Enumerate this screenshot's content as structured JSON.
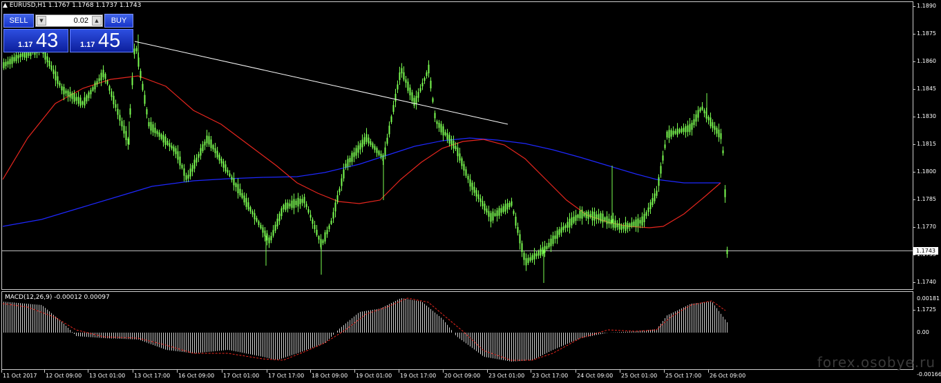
{
  "chart": {
    "title": "EURUSD,H1  1.1767 1.1768 1.1737 1.1743",
    "current_price": "1.1743",
    "colors": {
      "candle": "#7cff52",
      "ma_fast": "#e8261e",
      "ma_slow": "#1e28ff",
      "trendline": "#ffffff",
      "macd_signal": "#e8261e",
      "macd_hist": "#cfcfcf"
    }
  },
  "trade_panel": {
    "sell_label": "SELL",
    "buy_label": "BUY",
    "lot_value": "0.02",
    "bid_small": "1.17",
    "bid_big": "43",
    "ask_small": "1.17",
    "ask_big": "45",
    "lot_down_icon": "triangle-down-icon",
    "lot_up_icon": "triangle-up-icon"
  },
  "price_axis": {
    "labels": [
      "1.1890",
      "1.1875",
      "1.1860",
      "1.1845",
      "1.1830",
      "1.1815",
      "1.1800",
      "1.1785",
      "1.1770",
      "1.1755",
      "1.1740",
      "1.1725"
    ]
  },
  "macd": {
    "label": "MACD(12,26,9) -0.00012 0.00097",
    "axis_labels": [
      "0.00181",
      "0.00",
      "-0.00166"
    ]
  },
  "time_axis": {
    "labels": [
      "11 Oct 2017",
      "12 Oct 09:00",
      "13 Oct 01:00",
      "13 Oct 17:00",
      "16 Oct 09:00",
      "17 Oct 01:00",
      "17 Oct 17:00",
      "18 Oct 09:00",
      "19 Oct 01:00",
      "19 Oct 17:00",
      "20 Oct 09:00",
      "23 Oct 01:00",
      "23 Oct 17:00",
      "24 Oct 09:00",
      "25 Oct 01:00",
      "25 Oct 17:00",
      "26 Oct 09:00"
    ]
  },
  "watermark": "forex.osobye.ru"
}
